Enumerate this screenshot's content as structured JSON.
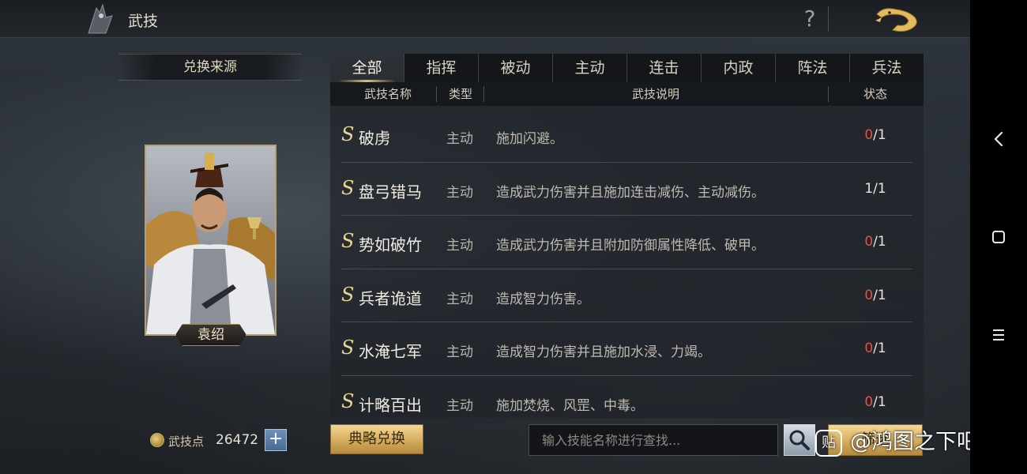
{
  "header": {
    "title": "武技",
    "help_label": "?"
  },
  "left_panel": {
    "source_title": "兑换来源",
    "hero_name": "袁绍",
    "points_label": "武技点",
    "points_value": "26472",
    "add_label": "+"
  },
  "tabs": [
    {
      "label": "全部",
      "active": true
    },
    {
      "label": "指挥",
      "active": false
    },
    {
      "label": "被动",
      "active": false
    },
    {
      "label": "主动",
      "active": false
    },
    {
      "label": "连击",
      "active": false
    },
    {
      "label": "内政",
      "active": false
    },
    {
      "label": "阵法",
      "active": false
    },
    {
      "label": "兵法",
      "active": false
    }
  ],
  "table": {
    "columns": {
      "name": "武技名称",
      "type": "类型",
      "desc": "武技说明",
      "status": "状态"
    },
    "rows": [
      {
        "grade": "S",
        "name": "破虏",
        "type": "主动",
        "desc": "施加闪避。",
        "cur": "0",
        "max": "/1"
      },
      {
        "grade": "S",
        "name": "盘弓错马",
        "type": "主动",
        "desc": "造成武力伤害并且施加连击减伤、主动减伤。",
        "cur": "1",
        "max": "/1"
      },
      {
        "grade": "S",
        "name": "势如破竹",
        "type": "主动",
        "desc": "造成武力伤害并且附加防御属性降低、破甲。",
        "cur": "0",
        "max": "/1"
      },
      {
        "grade": "S",
        "name": "兵者诡道",
        "type": "主动",
        "desc": "造成智力伤害。",
        "cur": "0",
        "max": "/1"
      },
      {
        "grade": "S",
        "name": "水淹七军",
        "type": "主动",
        "desc": "造成智力伤害并且施加水浸、力竭。",
        "cur": "0",
        "max": "/1"
      },
      {
        "grade": "S",
        "name": "计略百出",
        "type": "主动",
        "desc": "施加焚烧、风罡、中毒。",
        "cur": "0",
        "max": "/1"
      }
    ]
  },
  "footer": {
    "exchange_label": "典略兑换",
    "search_placeholder": "输入技能名称进行查找...",
    "filter_label": "筛选"
  },
  "watermark": {
    "logo_text": "贴",
    "text": "@鸿图之下吧"
  },
  "colors": {
    "accent_gold": "#d4ac5c",
    "status_zero": "#e0524a",
    "grade_s": "#e8d58a"
  }
}
